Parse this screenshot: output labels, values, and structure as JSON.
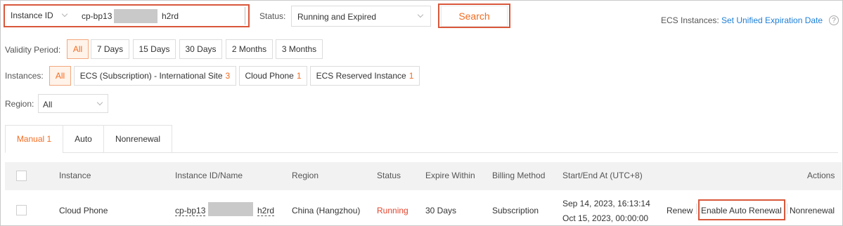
{
  "search": {
    "field_label": "Instance ID",
    "query_prefix": "cp-bp13",
    "query_suffix": "h2rd",
    "status_label": "Status:",
    "status_value": "Running and Expired",
    "button_label": "Search"
  },
  "header_right": {
    "label": "ECS Instances:",
    "link": "Set Unified Expiration Date",
    "help_glyph": "?"
  },
  "validity": {
    "label": "Validity Period:",
    "options": [
      "All",
      "7 Days",
      "15 Days",
      "30 Days",
      "2 Months",
      "3 Months"
    ],
    "selected": "All"
  },
  "instances": {
    "label": "Instances:",
    "options": [
      {
        "label": "All",
        "count": ""
      },
      {
        "label": "ECS (Subscription) - International Site",
        "count": "3"
      },
      {
        "label": "Cloud Phone",
        "count": "1"
      },
      {
        "label": "ECS Reserved Instance",
        "count": "1"
      }
    ],
    "selected": "All"
  },
  "region": {
    "label": "Region:",
    "value": "All"
  },
  "tabs": [
    {
      "label": "Manual 1",
      "active": true
    },
    {
      "label": "Auto",
      "active": false
    },
    {
      "label": "Nonrenewal",
      "active": false
    }
  ],
  "table": {
    "columns": [
      "Instance",
      "Instance ID/Name",
      "Region",
      "Status",
      "Expire Within",
      "Billing Method",
      "Start/End At (UTC+8)",
      "Actions"
    ],
    "rows": [
      {
        "instance": "Cloud Phone",
        "id_prefix": "cp-bp13",
        "id_suffix": "h2rd",
        "region": "China (Hangzhou)",
        "status": "Running",
        "expire_within": "30 Days",
        "billing_method": "Subscription",
        "start": "Sep 14, 2023, 16:13:14",
        "end": "Oct 15, 2023, 00:00:00",
        "actions": [
          "Renew",
          "Enable Auto Renewal",
          "Nonrenewal"
        ]
      }
    ]
  },
  "colors": {
    "accent": "#f36c21",
    "highlight_box": "#d9573b",
    "link": "#1d7fd6",
    "running": "#e2452d",
    "header_bg": "#f2f2f2"
  }
}
